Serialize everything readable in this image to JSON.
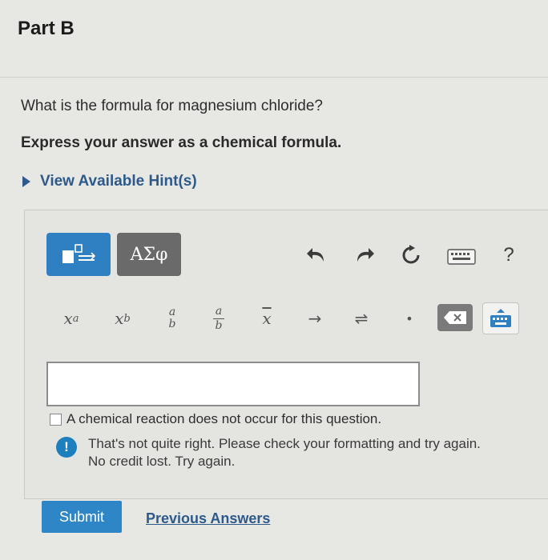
{
  "part": {
    "title": "Part B"
  },
  "question": {
    "text": "What is the formula for magnesium chloride?",
    "instruction": "Express your answer as a chemical formula."
  },
  "hints": {
    "label": "View Available Hint(s)"
  },
  "toolbar": {
    "greek_label": "ΑΣφ",
    "help_label": "?",
    "superscript": {
      "base": "x",
      "exp": "a"
    },
    "subscript": {
      "base": "x",
      "sub": "b"
    },
    "fraction_top": "a",
    "fraction_bottom": "b",
    "overline_x": "x",
    "arrow_right": "→",
    "arrow_eq": "⇌",
    "dot": "•"
  },
  "answer": {
    "value": ""
  },
  "no_reaction": {
    "label": "A chemical reaction does not occur for this question."
  },
  "feedback": {
    "icon": "!",
    "line1": "That's not quite right. Please check your formatting and try again.",
    "line2": "No credit lost. Try again."
  },
  "actions": {
    "submit_label": "Submit",
    "previous_label": "Previous Answers"
  },
  "colors": {
    "primary": "#2f86c6",
    "link": "#2d5a8a",
    "alert": "#1e7fbf"
  }
}
